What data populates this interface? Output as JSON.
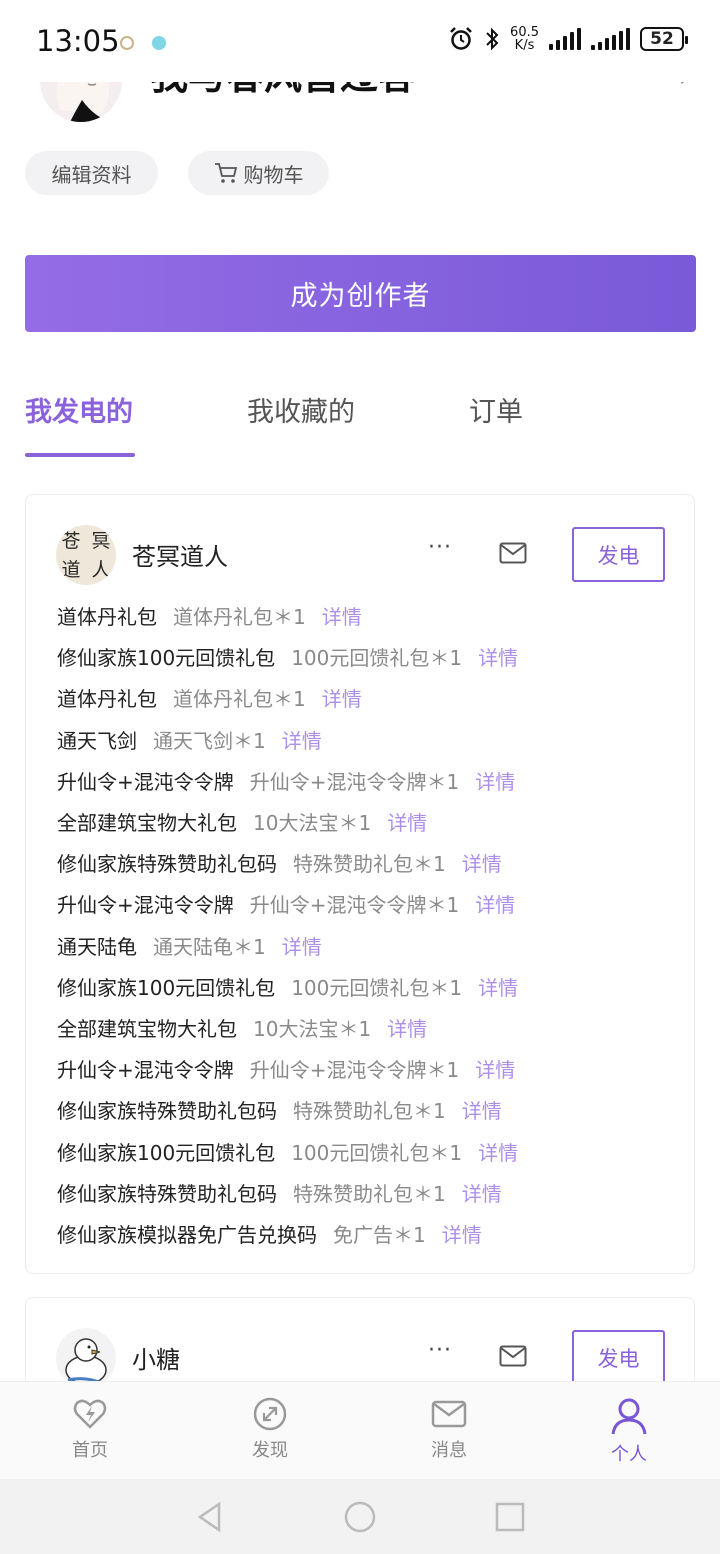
{
  "status_bar": {
    "time": "13:05",
    "net_speed_value": "60.5",
    "net_speed_unit": "K/s",
    "battery": "52",
    "icons": [
      "alarm-icon",
      "bluetooth-icon",
      "signal-icon",
      "signal-icon",
      "battery-icon"
    ]
  },
  "profile": {
    "name": "我与春风皆过客",
    "edit_label": "编辑资料",
    "cart_label": "购物车"
  },
  "creator_button": "成为创作者",
  "tabs": [
    {
      "label": "我发电的",
      "active": true
    },
    {
      "label": "我收藏的",
      "active": false
    },
    {
      "label": "订单",
      "active": false
    }
  ],
  "accent_color": "#8a62dc",
  "link_color": "#ac8fea",
  "cards": [
    {
      "name": "苍冥道人",
      "avatar_text": [
        "苍",
        "冥",
        "道",
        "人"
      ],
      "power_label": "发电",
      "items": [
        {
          "name": "道体丹礼包",
          "desc": "道体丹礼包＊1",
          "link": "详情"
        },
        {
          "name": "修仙家族100元回馈礼包",
          "desc": "100元回馈礼包＊1",
          "link": "详情"
        },
        {
          "name": "道体丹礼包",
          "desc": "道体丹礼包＊1",
          "link": "详情"
        },
        {
          "name": "通天飞剑",
          "desc": "通天飞剑＊1",
          "link": "详情"
        },
        {
          "name": "升仙令+混沌令令牌",
          "desc": "升仙令+混沌令令牌＊1",
          "link": "详情"
        },
        {
          "name": "全部建筑宝物大礼包",
          "desc": "10大法宝＊1",
          "link": "详情"
        },
        {
          "name": "修仙家族特殊赞助礼包码",
          "desc": "特殊赞助礼包＊1",
          "link": "详情"
        },
        {
          "name": "升仙令+混沌令令牌",
          "desc": "升仙令+混沌令令牌＊1",
          "link": "详情"
        },
        {
          "name": "通天陆龟",
          "desc": "通天陆龟＊1",
          "link": "详情"
        },
        {
          "name": "修仙家族100元回馈礼包",
          "desc": "100元回馈礼包＊1",
          "link": "详情"
        },
        {
          "name": "全部建筑宝物大礼包",
          "desc": "10大法宝＊1",
          "link": "详情"
        },
        {
          "name": "升仙令+混沌令令牌",
          "desc": "升仙令+混沌令令牌＊1",
          "link": "详情"
        },
        {
          "name": "修仙家族特殊赞助礼包码",
          "desc": "特殊赞助礼包＊1",
          "link": "详情"
        },
        {
          "name": "修仙家族100元回馈礼包",
          "desc": "100元回馈礼包＊1",
          "link": "详情"
        },
        {
          "name": "修仙家族特殊赞助礼包码",
          "desc": "特殊赞助礼包＊1",
          "link": "详情"
        },
        {
          "name": "修仙家族模拟器免广告兑换码",
          "desc": "免广告＊1",
          "link": "详情"
        }
      ]
    },
    {
      "name": "小糖",
      "power_label": "发电",
      "items": []
    }
  ],
  "bottom_nav": [
    {
      "label": "首页",
      "icon": "power-heart-icon",
      "active": false
    },
    {
      "label": "发现",
      "icon": "discover-icon",
      "active": false
    },
    {
      "label": "消息",
      "icon": "mail-icon",
      "active": false
    },
    {
      "label": "个人",
      "icon": "person-icon",
      "active": true
    }
  ],
  "system_nav": [
    "back-icon",
    "home-icon",
    "recents-icon"
  ]
}
